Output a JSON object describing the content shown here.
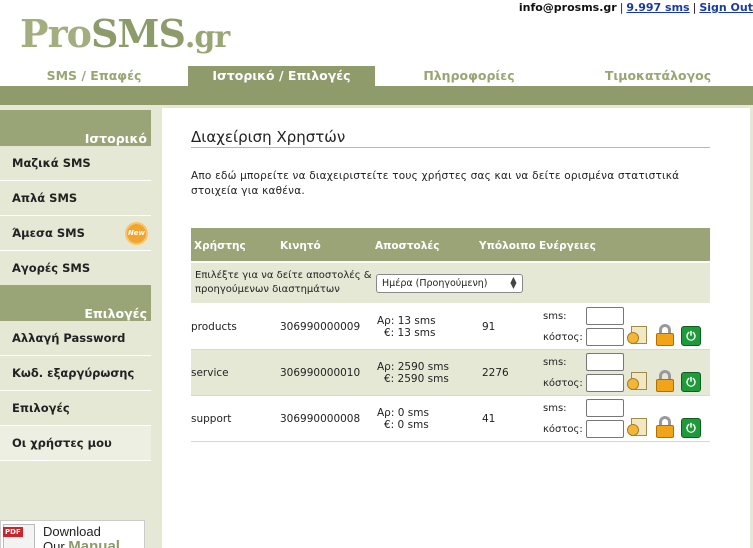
{
  "brand": {
    "logo_pro": "Pro",
    "logo_sms": "SMS",
    "logo_gr": ".gr"
  },
  "topbar": {
    "email": "info@prosms.gr",
    "credits": "9.997 sms",
    "signout": "Sign Out"
  },
  "tabs": [
    {
      "label": "SMS / Επαφές",
      "active": false
    },
    {
      "label": "Ιστορικό / Επιλογές",
      "active": true
    },
    {
      "label": "Πληροφορίες",
      "active": false
    },
    {
      "label": "Τιμοκατάλογος",
      "active": false
    }
  ],
  "sidebar": {
    "section1_title": "Ιστορικό",
    "section1_items": [
      "Μαζικά SMS",
      "Απλά SMS",
      "Άμεσα SMS",
      "Αγορές SMS"
    ],
    "new_badge": "New",
    "section2_title": "Επιλογές",
    "section2_items": [
      "Αλλαγή Password",
      "Κωδ. εξαργύρωσης",
      "Επιλογές",
      "Οι χρήστες μου"
    ],
    "active_item": "Οι χρήστες μου"
  },
  "manual": {
    "pdf_label": "PDF",
    "line1": "Download",
    "line2_prefix": "Our",
    "line2_word": "Manual"
  },
  "main": {
    "title": "Διαχείριση Χρηστών",
    "description": "Απο εδώ μπορείτε να διαχειριστείτε τους χρήστες σας και να δείτε ορισμένα στατιστικά στοιχεία για καθένα.",
    "columns": [
      "Χρήστης",
      "Κινητό",
      "Αποστολές",
      "Υπόλοιπο",
      "Ενέργειες"
    ],
    "filter_label": "Επιλέξτε για να δείτε αποστολές & προηγούμενων διαστημάτων",
    "period_selected": "Ημέρα (Προηγούμενη)",
    "sms_label": "sms:",
    "cost_label": "κόστος:",
    "users": [
      {
        "name": "products",
        "mobile": "306990000009",
        "count_line": "Αρ: 13 sms",
        "cost_line": "€: 13 sms",
        "balance": "91"
      },
      {
        "name": "service",
        "mobile": "306990000010",
        "count_line": "Αρ: 2590 sms",
        "cost_line": "€: 2590 sms",
        "balance": "2276"
      },
      {
        "name": "support",
        "mobile": "306990000008",
        "count_line": "Αρ: 0 sms",
        "cost_line": "€: 0 sms",
        "balance": "41"
      }
    ]
  },
  "colors": {
    "accent": "#8f9b6b",
    "panel": "#e6e8d6",
    "tab_text": "#9aa574"
  },
  "icons": [
    "add-credits-icon",
    "lock-icon",
    "power-icon",
    "pdf-icon",
    "new-badge-icon"
  ]
}
